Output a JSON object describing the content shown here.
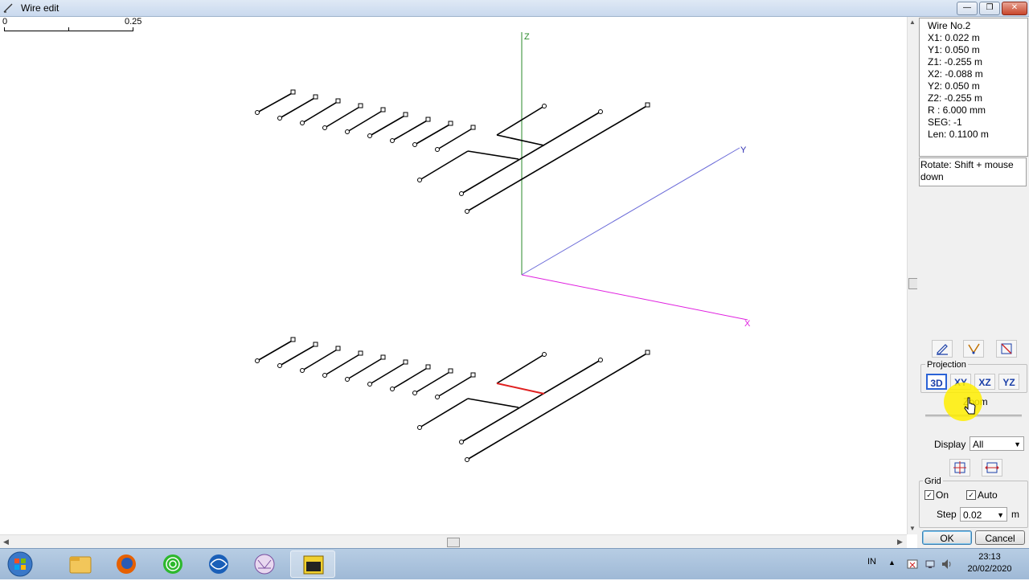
{
  "window": {
    "title": "Wire edit",
    "minimize_label": "—",
    "maximize_label": "❐",
    "close_label": "✕"
  },
  "scale": {
    "zero": "0",
    "max": "0.25"
  },
  "axes": {
    "z": "Z",
    "y": "Y",
    "x": "X"
  },
  "colors": {
    "z_axis": "#2a8a2a",
    "y_axis": "#6a6ad8",
    "x_axis": "#e020e0",
    "wire": "#000000",
    "selected_wire": "#e02020",
    "highlight": "#ffee00"
  },
  "info": {
    "wire_no": "Wire No.2",
    "x1": "X1: 0.022 m",
    "y1": "Y1: 0.050 m",
    "z1": "Z1: -0.255 m",
    "x2": "X2: -0.088 m",
    "y2": "Y2: 0.050 m",
    "z2": "Z2: -0.255 m",
    "r": "R : 6.000 mm",
    "seg": "SEG: -1",
    "len": "Len: 0.1100 m"
  },
  "hint": "Rotate: Shift + mouse down",
  "tools": [
    "pencil-icon",
    "wire-angle-icon",
    "box-diagonal-icon"
  ],
  "projection": {
    "label": "Projection",
    "buttons": [
      "3D",
      "XY",
      "XZ",
      "YZ"
    ],
    "active": "3D",
    "zoom_label": "Zoom"
  },
  "display": {
    "label": "Display",
    "value": "All"
  },
  "grid": {
    "label": "Grid",
    "on_label": "On",
    "on_checked": true,
    "auto_label": "Auto",
    "auto_checked": true,
    "step_label": "Step",
    "step_value": "0.02",
    "unit": "m"
  },
  "buttons": {
    "ok": "OK",
    "cancel": "Cancel"
  },
  "taskbar": {
    "items": [
      "file-explorer-icon",
      "firefox-icon",
      "green-target-icon",
      "blue-globe-icon",
      "mmana-icon",
      "video-app-icon"
    ],
    "active": "video-app-icon",
    "lang": "IN",
    "time": "23:13",
    "date": "20/02/2020"
  }
}
